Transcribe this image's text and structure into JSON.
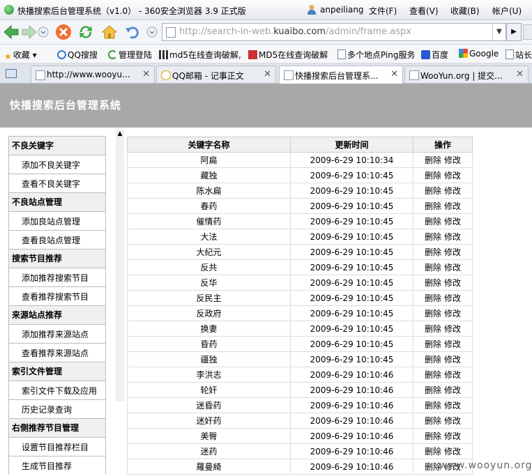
{
  "browser": {
    "window_title": "快播搜索后台管理系统（v1.0） - 360安全浏览器 3.9 正式版",
    "user": "anpeiliang",
    "menu": [
      "文件(F)",
      "查看(V)",
      "收藏(B)",
      "帐户(U)"
    ],
    "url_prefix": "http://search-in-web.",
    "url_domain": "kuaibo.com",
    "url_path": "/admin/frame.aspx",
    "favorites_label": "收藏",
    "favorites": [
      "QQ搜搜",
      "管理登陆",
      "md5在线查询破解,",
      "MD5在线查询破解",
      "多个地点Ping服务",
      "百度",
      "Google",
      "站长"
    ],
    "tabs": [
      {
        "label": "http://www.wooyu..."
      },
      {
        "label": "QQ邮箱 - 记事正文"
      },
      {
        "label": "快播搜索后台管理系..."
      },
      {
        "label": "WooYun.org | 提交..."
      }
    ]
  },
  "header": {
    "title": "快播搜索后台管理系统"
  },
  "sidebar": {
    "sections": [
      {
        "title": "不良关键字",
        "items": [
          "添加不良关键字",
          "查看不良关键字"
        ]
      },
      {
        "title": "不良站点管理",
        "items": [
          "添加良站点管理",
          "查看良站点管理"
        ]
      },
      {
        "title": "搜索节目推荐",
        "items": [
          "添加推荐搜索节目",
          "查看推荐搜索节目"
        ]
      },
      {
        "title": "来源站点推荐",
        "items": [
          "添加推荐来源站点",
          "查看推荐来源站点"
        ]
      },
      {
        "title": "索引文件管理",
        "items": [
          "索引文件下载及应用",
          "历史记录查询"
        ]
      },
      {
        "title": "右侧推荐节目管理",
        "items": [
          "设置节目推荐栏目",
          "生成节目推荐"
        ]
      }
    ]
  },
  "table": {
    "headers": [
      "关键字名称",
      "更新时间",
      "操作"
    ],
    "delete_label": "删除",
    "edit_label": "修改",
    "rows": [
      {
        "keyword": "阿扁",
        "time": "2009-6-29 10:10:34"
      },
      {
        "keyword": "藏独",
        "time": "2009-6-29 10:10:45"
      },
      {
        "keyword": "陈水扁",
        "time": "2009-6-29 10:10:45"
      },
      {
        "keyword": "春药",
        "time": "2009-6-29 10:10:45"
      },
      {
        "keyword": "催情药",
        "time": "2009-6-29 10:10:45"
      },
      {
        "keyword": "大法",
        "time": "2009-6-29 10:10:45"
      },
      {
        "keyword": "大纪元",
        "time": "2009-6-29 10:10:45"
      },
      {
        "keyword": "反共",
        "time": "2009-6-29 10:10:45"
      },
      {
        "keyword": "反华",
        "time": "2009-6-29 10:10:45"
      },
      {
        "keyword": "反民主",
        "time": "2009-6-29 10:10:45"
      },
      {
        "keyword": "反政府",
        "time": "2009-6-29 10:10:45"
      },
      {
        "keyword": "换妻",
        "time": "2009-6-29 10:10:45"
      },
      {
        "keyword": "昏药",
        "time": "2009-6-29 10:10:45"
      },
      {
        "keyword": "疆独",
        "time": "2009-6-29 10:10:45"
      },
      {
        "keyword": "李洪志",
        "time": "2009-6-29 10:10:46"
      },
      {
        "keyword": "轮奸",
        "time": "2009-6-29 10:10:46"
      },
      {
        "keyword": "迷昏药",
        "time": "2009-6-29 10:10:46"
      },
      {
        "keyword": "迷奸药",
        "time": "2009-6-29 10:10:46"
      },
      {
        "keyword": "美臀",
        "time": "2009-6-29 10:10:46"
      },
      {
        "keyword": "迷药",
        "time": "2009-6-29 10:10:46"
      },
      {
        "keyword": "羅曼綺",
        "time": "2009-6-29 10:10:46"
      }
    ]
  },
  "watermark": "www.wooyun.org"
}
